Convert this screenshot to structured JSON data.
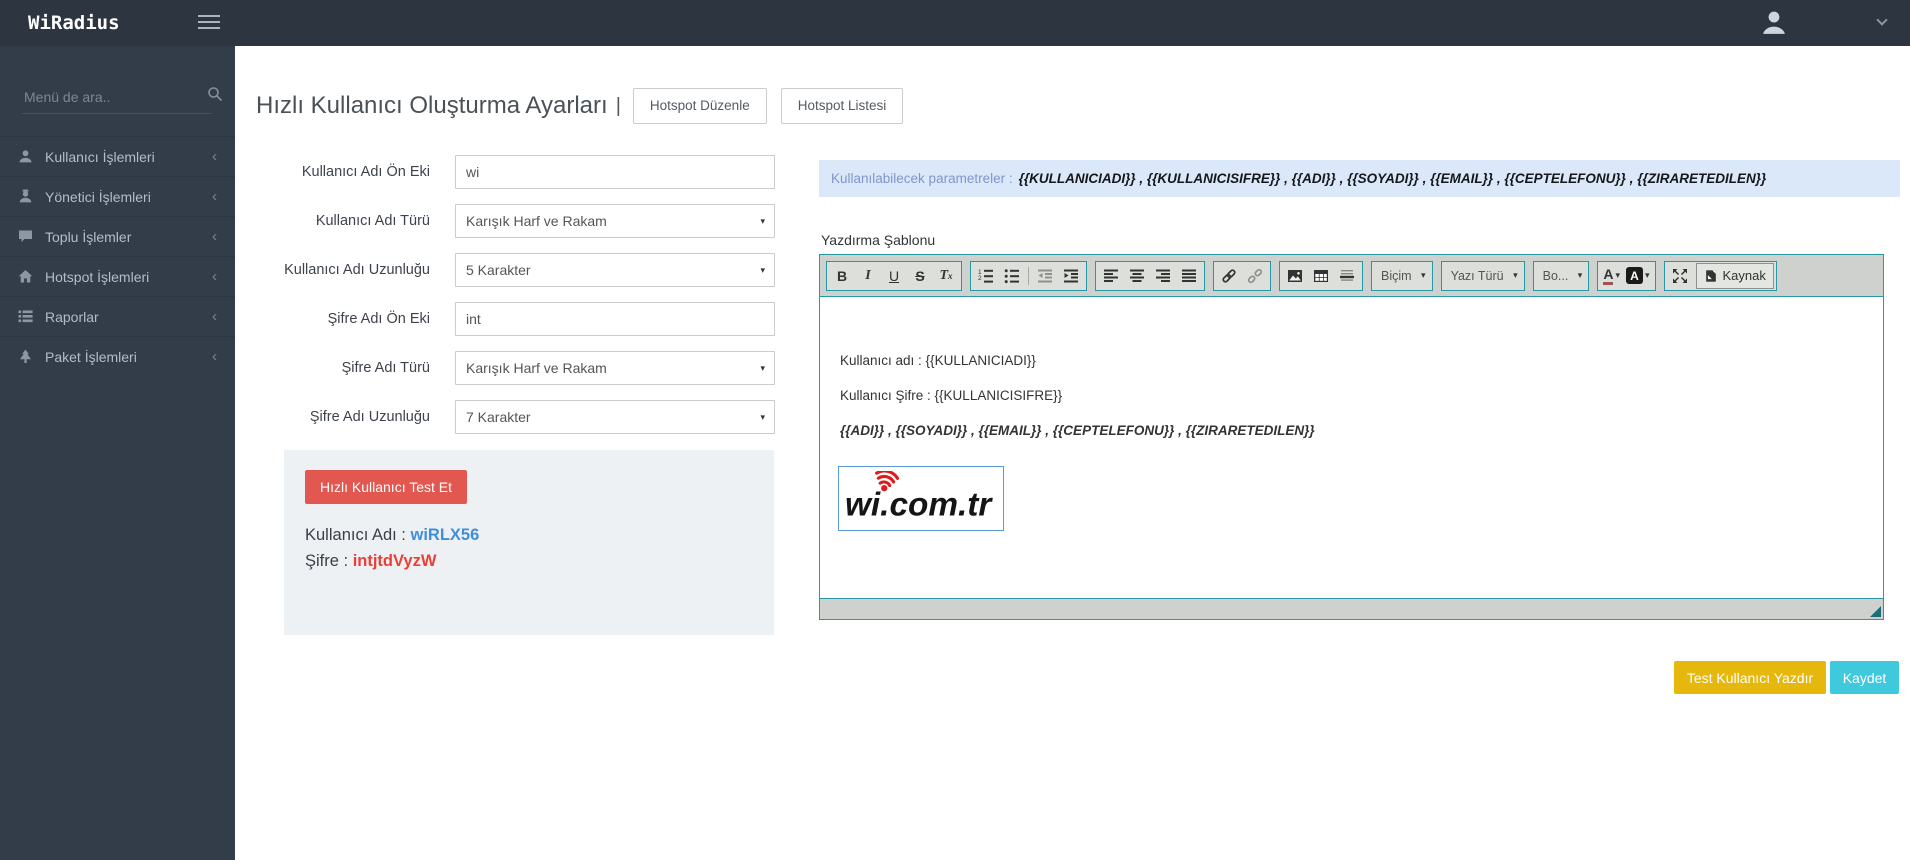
{
  "navbar": {
    "brand": "WiRadius"
  },
  "icons": {
    "chevron_left": "‹",
    "caret_down": "▾"
  },
  "sidebar": {
    "search_placeholder": "Menü de ara..",
    "items": [
      {
        "label": "Kullanıcı İşlemleri",
        "icon": "user-icon"
      },
      {
        "label": "Yönetici İşlemleri",
        "icon": "admin-icon"
      },
      {
        "label": "Toplu İşlemler",
        "icon": "comment-icon"
      },
      {
        "label": "Hotspot İşlemleri",
        "icon": "home-icon"
      },
      {
        "label": "Raporlar",
        "icon": "list-icon"
      },
      {
        "label": "Paket İşlemleri",
        "icon": "tree-icon"
      }
    ]
  },
  "page": {
    "title": "Hızlı Kullanıcı Oluşturma Ayarları",
    "title_separator": "|",
    "hotspot_edit_button": "Hotspot Düzenle",
    "hotspot_list_button": "Hotspot Listesi"
  },
  "form": {
    "fields": [
      {
        "label": "Kullanıcı Adı Ön Eki",
        "control": "text",
        "value": "wi"
      },
      {
        "label": "Kullanıcı Adı Türü",
        "control": "select",
        "value": "Karışık Harf ve Rakam"
      },
      {
        "label": "Kullanıcı Adı Uzunluğu",
        "control": "select",
        "value": "5 Karakter"
      },
      {
        "label": "Şifre Adı Ön Eki",
        "control": "text",
        "value": "int"
      },
      {
        "label": "Şifre Adı Türü",
        "control": "select",
        "value": "Karışık Harf ve Rakam"
      },
      {
        "label": "Şifre Adı Uzunluğu",
        "control": "select",
        "value": "7 Karakter"
      }
    ]
  },
  "test_panel": {
    "test_button_label": "Hızlı Kullanıcı Test Et",
    "username_label": "Kullanıcı Adı : ",
    "username_value": "wiRLX56",
    "password_label": "Şifre : ",
    "password_value": "intjtdVyzW"
  },
  "parameters_bar": {
    "label": "Kullanılabilecek parametreler :",
    "parameters": "{{KULLANICIADI}} , {{KULLANICISIFRE}} , {{ADI}} , {{SOYADI}} , {{EMAIL}} , {{CEPTELEFONU}} , {{ZIRARETEDILEN}}"
  },
  "editor": {
    "label": "Yazdırma Şablonu",
    "toolbar": {
      "bold": "B",
      "italic": "I",
      "underline": "U",
      "strikethrough": "S",
      "remove_format_t": "T",
      "remove_format_x": "x",
      "format_dropdown": "Biçim",
      "font_dropdown": "Yazı Türü",
      "size_dropdown": "Bo...",
      "color_letter_fg": "A",
      "color_letter_bg": "A",
      "source_button": "Kaynak"
    },
    "content": {
      "line1": "Kullanıcı adı : {{KULLANICIADI}}",
      "line2": "Kullanıcı Şifre : {{KULLANICISIFRE}}",
      "line3": "{{ADI}} , {{SOYADI}} , {{EMAIL}} , {{CEPTELEFONU}} , {{ZIRARETEDILEN}}",
      "logo_text": "wi.com.tr"
    }
  },
  "actions": {
    "print_test_user": "Test Kullanıcı Yazdır",
    "save": "Kaydet"
  },
  "colors": {
    "navbar_bg": "#2d3640",
    "sidebar_bg": "#333d49",
    "accent_teal": "#2599a6",
    "info_bar_bg": "#dbe8f9",
    "danger_button": "#e2574f",
    "username_color": "#3f8fd8",
    "password_color": "#ea3f38",
    "print_button_bg": "#e6b70d",
    "save_button_bg": "#3ec9dc"
  }
}
